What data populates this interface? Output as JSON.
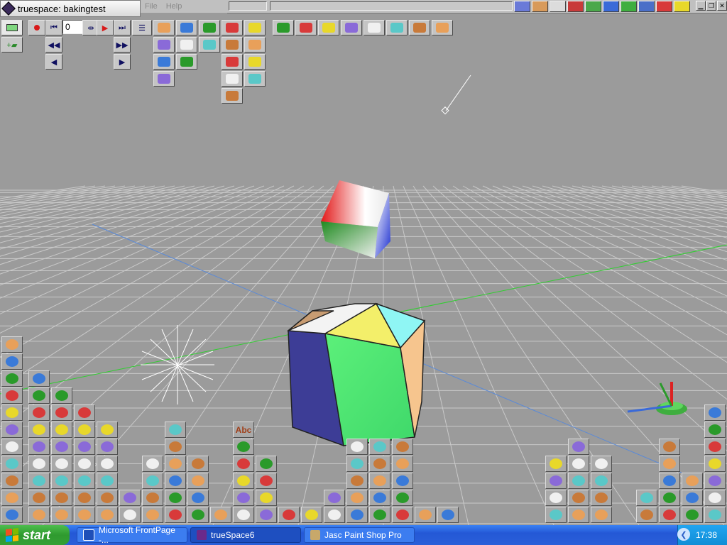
{
  "window": {
    "title": "truespace: bakingtest"
  },
  "menu": {
    "items": [
      "File",
      "Help"
    ]
  },
  "animation": {
    "frame_value": "0"
  },
  "library": {
    "text_tool_label": "Abc"
  },
  "taskbar": {
    "start_label": "start",
    "tasks": [
      {
        "label": "Microsoft FrontPage -...",
        "icon": "frontpage-icon",
        "active": false
      },
      {
        "label": "trueSpace6",
        "icon": "truespace-icon",
        "active": true
      },
      {
        "label": "Jasc Paint Shop Pro",
        "icon": "paintshop-icon",
        "active": false
      }
    ],
    "clock": "17:38"
  },
  "colors": {
    "viewport": "#9b9b9b",
    "grid": "#c9c9c9",
    "x_axis": "#2fcf2f",
    "z_axis": "#5a8ad8",
    "taskbar": "#2a5fd9",
    "start": "#34a034"
  },
  "scene_objects": [
    "gradient-cube",
    "polyhedron",
    "point-light",
    "spot-light",
    "gizmo"
  ],
  "icons": [
    "record-icon",
    "go-start-icon",
    "play-icon",
    "go-end-icon",
    "rewind-icon",
    "fast-forward-icon",
    "prev-frame-icon",
    "next-frame-icon",
    "keyframe-list-icon",
    "object-tool-icons",
    "path-tool-icons",
    "render-tool-icons",
    "navigation-tool-icons",
    "primitive-library-icons",
    "material-library-icons",
    "undo-icon",
    "help-icon"
  ]
}
